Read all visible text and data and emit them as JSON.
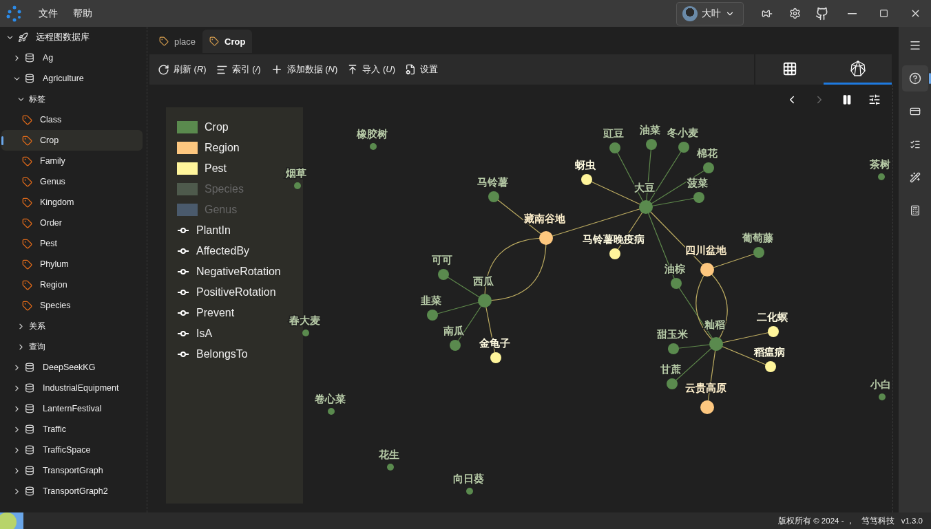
{
  "menu": [
    "文件",
    "帮助"
  ],
  "user": {
    "name": "大叶"
  },
  "sidebar": {
    "tree": [
      {
        "label": "远程图数据库",
        "kind": "server",
        "expanded": true,
        "children": [
          {
            "label": "Ag",
            "kind": "db",
            "expanded": false
          },
          {
            "label": "Agriculture",
            "kind": "db",
            "expanded": true,
            "children": [
              {
                "label": "标签",
                "kind": "group",
                "expanded": true,
                "children": [
                  {
                    "label": "Class",
                    "kind": "tag",
                    "selected": false
                  },
                  {
                    "label": "Crop",
                    "kind": "tag",
                    "selected": true
                  },
                  {
                    "label": "Family",
                    "kind": "tag",
                    "selected": false
                  },
                  {
                    "label": "Genus",
                    "kind": "tag",
                    "selected": false
                  },
                  {
                    "label": "Kingdom",
                    "kind": "tag",
                    "selected": false
                  },
                  {
                    "label": "Order",
                    "kind": "tag",
                    "selected": false
                  },
                  {
                    "label": "Pest",
                    "kind": "tag",
                    "selected": false
                  },
                  {
                    "label": "Phylum",
                    "kind": "tag",
                    "selected": false
                  },
                  {
                    "label": "Region",
                    "kind": "tag",
                    "selected": false
                  },
                  {
                    "label": "Species",
                    "kind": "tag",
                    "selected": false
                  }
                ]
              },
              {
                "label": "关系",
                "kind": "group",
                "expanded": false
              },
              {
                "label": "查询",
                "kind": "group",
                "expanded": false
              }
            ]
          },
          {
            "label": "DeepSeekKG",
            "kind": "db",
            "expanded": false
          },
          {
            "label": "IndustrialEquipment",
            "kind": "db",
            "expanded": false
          },
          {
            "label": "LanternFestival",
            "kind": "db",
            "expanded": false
          },
          {
            "label": "Traffic",
            "kind": "db",
            "expanded": false
          },
          {
            "label": "TrafficSpace",
            "kind": "db",
            "expanded": false
          },
          {
            "label": "TransportGraph",
            "kind": "db",
            "expanded": false
          },
          {
            "label": "TransportGraph2",
            "kind": "db",
            "expanded": false
          }
        ]
      }
    ]
  },
  "tabs": [
    {
      "label": "place",
      "selected": false
    },
    {
      "label": "Crop",
      "selected": true
    }
  ],
  "toolbar": [
    {
      "kind": "refresh",
      "label": "刷新 (*R*)"
    },
    {
      "kind": "index",
      "label": "索引 (*/*)"
    },
    {
      "kind": "add",
      "label": "添加数据 (*N*)"
    },
    {
      "kind": "import",
      "label": "导入 (*U*)"
    },
    {
      "kind": "settings",
      "label": "设置"
    }
  ],
  "views": [
    {
      "kind": "table",
      "selected": false
    },
    {
      "kind": "graph",
      "selected": true
    }
  ],
  "graph_controls": [
    {
      "kind": "prev",
      "disabled": false
    },
    {
      "kind": "next",
      "disabled": true
    },
    {
      "kind": "pause",
      "disabled": false
    },
    {
      "kind": "tune",
      "disabled": false
    }
  ],
  "legend": {
    "labels": [
      {
        "label": "Crop",
        "color": "#5a8a4e",
        "on": true
      },
      {
        "label": "Region",
        "color": "#fdc77f",
        "on": true
      },
      {
        "label": "Pest",
        "color": "#fff59b",
        "on": true
      },
      {
        "label": "Species",
        "color": "#4e5a4c",
        "on": false
      },
      {
        "label": "Genus",
        "color": "#4a5a6c",
        "on": false
      }
    ],
    "relations": [
      "PlantIn",
      "AffectedBy",
      "NegativeRotation",
      "PositiveRotation",
      "Prevent",
      "IsA",
      "BelongsTo"
    ]
  },
  "graph": {
    "nodes": [
      {
        "label": "橡胶树",
        "kind": "crop"
      },
      {
        "label": "烟草",
        "kind": "crop"
      },
      {
        "label": "春大麦",
        "kind": "crop"
      },
      {
        "label": "卷心菜",
        "kind": "crop"
      },
      {
        "label": "花生",
        "kind": "crop"
      },
      {
        "label": "向日葵",
        "kind": "crop"
      },
      {
        "label": "茶树",
        "kind": "crop"
      },
      {
        "label": "小白",
        "kind": "crop"
      },
      {
        "label": "马铃薯",
        "kind": "crop"
      },
      {
        "label": "藏南谷地",
        "kind": "region"
      },
      {
        "label": "蚜虫",
        "kind": "pest"
      },
      {
        "label": "大豆",
        "kind": "crop"
      },
      {
        "label": "豇豆",
        "kind": "crop"
      },
      {
        "label": "油菜",
        "kind": "crop"
      },
      {
        "label": "冬小麦",
        "kind": "crop"
      },
      {
        "label": "棉花",
        "kind": "crop"
      },
      {
        "label": "菠菜",
        "kind": "crop"
      },
      {
        "label": "马铃薯晚疫病",
        "kind": "pest"
      },
      {
        "label": "四川盆地",
        "kind": "region"
      },
      {
        "label": "葡萄藤",
        "kind": "crop"
      },
      {
        "label": "油棕",
        "kind": "crop"
      },
      {
        "label": "籼稻",
        "kind": "crop"
      },
      {
        "label": "二化螟",
        "kind": "pest"
      },
      {
        "label": "稻瘟病",
        "kind": "pest"
      },
      {
        "label": "甜玉米",
        "kind": "crop"
      },
      {
        "label": "甘蔗",
        "kind": "crop"
      },
      {
        "label": "云贵高原",
        "kind": "region"
      },
      {
        "label": "西瓜",
        "kind": "crop"
      },
      {
        "label": "可可",
        "kind": "crop"
      },
      {
        "label": "韭菜",
        "kind": "crop"
      },
      {
        "label": "南瓜",
        "kind": "crop"
      },
      {
        "label": "金龟子",
        "kind": "pest"
      }
    ]
  },
  "footer": {
    "copyright": "版权所有 © 2024 - ，",
    "company": "笃笃科技",
    "version": "v1.3.0"
  }
}
